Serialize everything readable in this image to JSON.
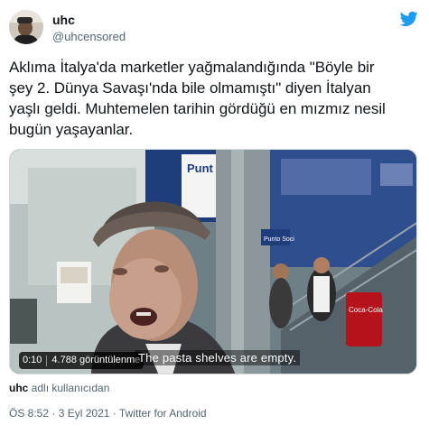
{
  "author": {
    "display_name": "uhc",
    "handle": "@uhcensored"
  },
  "tweet": {
    "text_line1": "Aklıma İtalya'da marketler yağmalandığında \"Böyle bir",
    "text_line2": "şey 2. Dünya Savaşı'nda bile olmamıştı\" diyen İtalyan",
    "text_line3": "yaşlı geldi. Muhtemelen tarihin gördüğü en mızmız nesil",
    "text_line4": "bugün yaşayanlar."
  },
  "video": {
    "elapsed": "0:10",
    "views": "4.788 görüntülenme",
    "subtitle": "The pasta shelves are empty.",
    "sign_text": "Punt Soci",
    "sign_small": "Punto Soci",
    "cup_text": "Coca-Cola"
  },
  "attribution": {
    "user": "uhc",
    "suffix": " adlı kullanıcıdan"
  },
  "meta": {
    "time": "ÖS 8:52",
    "dot1": " · ",
    "date": "3 Eyl 2021",
    "dot2": " · ",
    "client": "Twitter for Android"
  },
  "colors": {
    "twitter_blue": "#1d9bf0",
    "text_primary": "#0f1419",
    "text_secondary": "#536471"
  },
  "icons": {
    "logo": "twitter-bird-icon"
  }
}
